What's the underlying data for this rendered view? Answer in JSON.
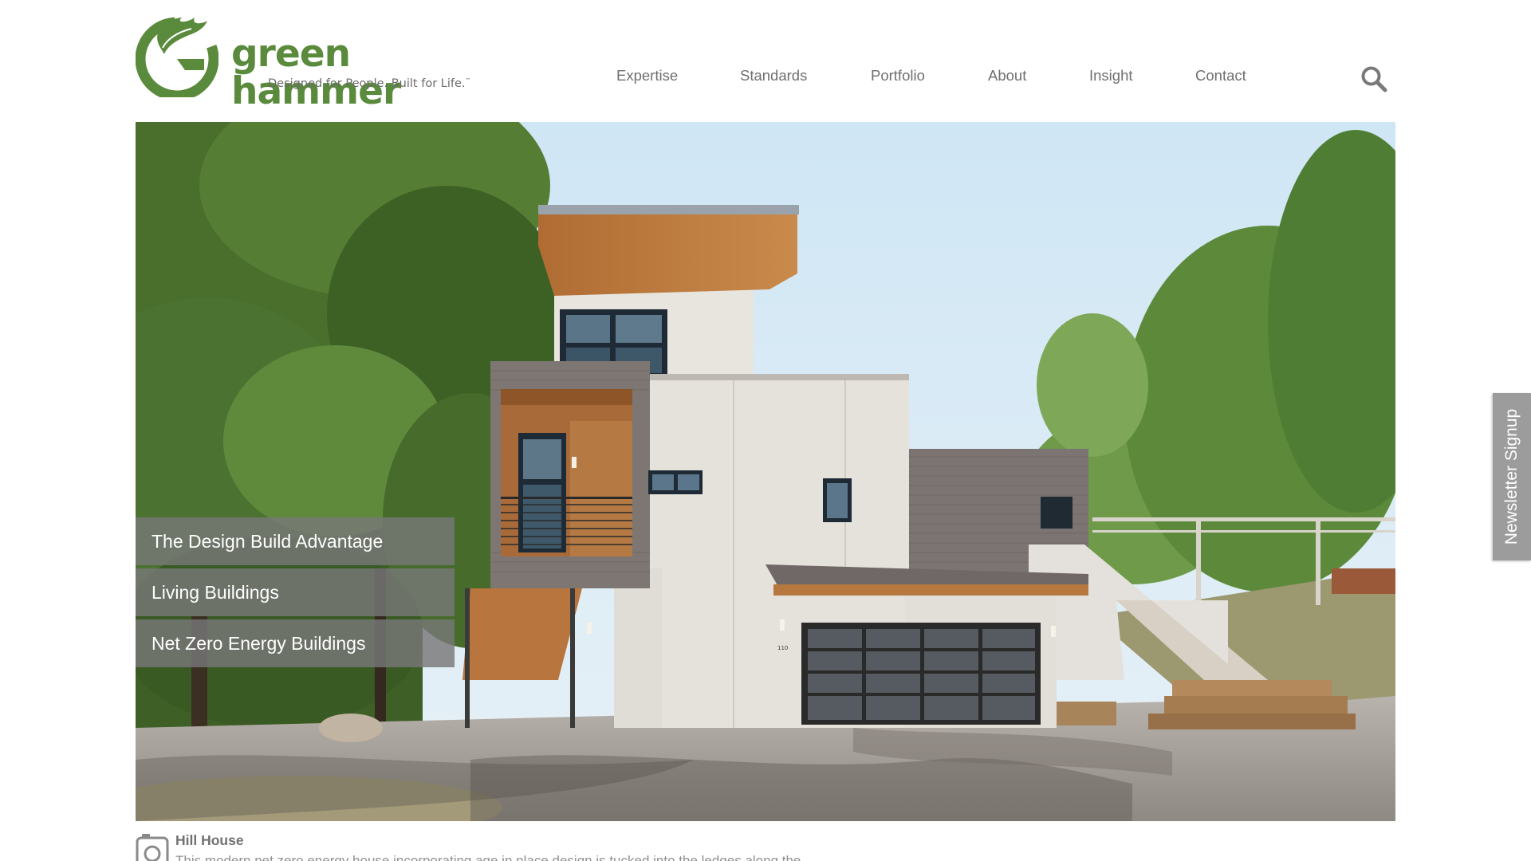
{
  "brand": {
    "name": "green hammer",
    "tagline": "Designed for People. Built for Life.",
    "trademark": "™",
    "color": "#5a8a3c"
  },
  "nav": {
    "items": [
      {
        "label": "Expertise"
      },
      {
        "label": "Standards"
      },
      {
        "label": "Portfolio"
      },
      {
        "label": "About"
      },
      {
        "label": "Insight"
      },
      {
        "label": "Contact"
      }
    ],
    "search_icon": "search-icon"
  },
  "hero": {
    "menu": [
      {
        "label": "The Design Build Advantage"
      },
      {
        "label": "Living Buildings"
      },
      {
        "label": "Net Zero Energy Buildings"
      }
    ],
    "house_number": "110"
  },
  "caption": {
    "icon": "camera-icon",
    "title": "Hill House",
    "description": "This modern net zero energy house incorporating age in place design is tucked into the ledges along the"
  },
  "newsletter": {
    "label": "Newsletter Signup"
  }
}
